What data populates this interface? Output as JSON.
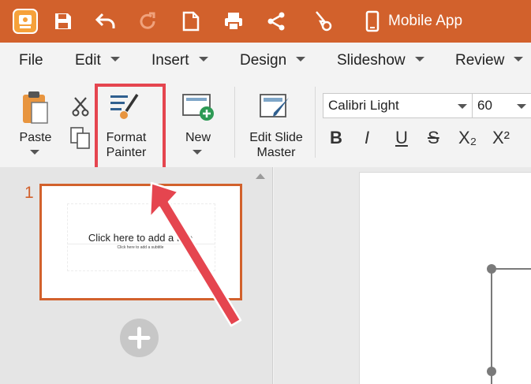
{
  "titlebar": {
    "app_label": "Mobile App",
    "icons": [
      "app-logo-icon",
      "save-icon",
      "undo-icon",
      "redo-icon",
      "new-document-icon",
      "print-icon",
      "share-icon",
      "cast-icon",
      "mobile-device-icon"
    ]
  },
  "menu": {
    "items": [
      "File",
      "Edit",
      "Insert",
      "Design",
      "Slideshow",
      "Review"
    ]
  },
  "ribbon": {
    "paste_label": "Paste",
    "format_painter_line1": "Format",
    "format_painter_line2": "Painter",
    "new_label": "New",
    "edit_master_line1": "Edit Slide",
    "edit_master_line2": "Master",
    "font_name": "Calibri Light",
    "font_size": "60",
    "format_buttons": [
      "B",
      "I",
      "U",
      "S",
      "X₂",
      "X²"
    ]
  },
  "slides_panel": {
    "slide_number": "1",
    "thumb_title": "Click here to add a title",
    "thumb_subtitle": "Click here to add a subtitle"
  },
  "colors": {
    "accent": "#d2612c",
    "annotation": "#e5454f"
  }
}
